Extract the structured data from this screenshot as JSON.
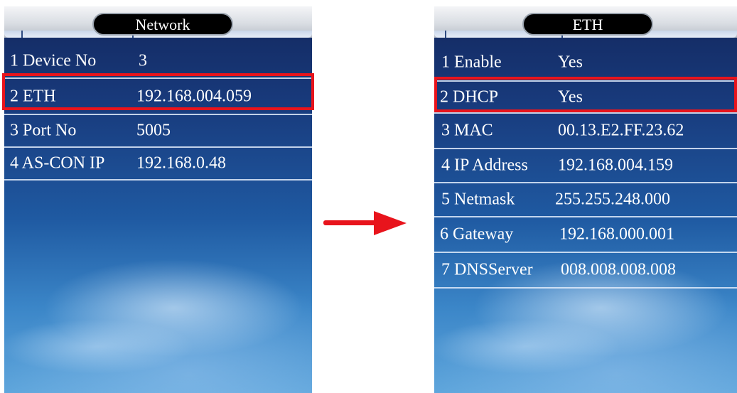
{
  "left_screen": {
    "title": "Network",
    "rows": [
      {
        "label": "1 Device No",
        "value": "3"
      },
      {
        "label": "2 ETH",
        "value": "192.168.004.059"
      },
      {
        "label": "3 Port No",
        "value": "5005"
      },
      {
        "label": "4 AS-CON IP",
        "value": "192.168.0.48"
      }
    ],
    "highlighted_row": "2 ETH"
  },
  "right_screen": {
    "title": "ETH",
    "rows": [
      {
        "label": "1 Enable",
        "value": "Yes"
      },
      {
        "label": "2 DHCP",
        "value": "Yes"
      },
      {
        "label": "3 MAC",
        "value": "00.13.E2.FF.23.62"
      },
      {
        "label": "4 IP Address",
        "value": "192.168.004.159"
      },
      {
        "label": "5 Netmask",
        "value": "255.255.248.000"
      },
      {
        "label": "6 Gateway",
        "value": "192.168.000.001"
      },
      {
        "label": "7 DNSServer",
        "value": "008.008.008.008"
      }
    ],
    "highlighted_row": "2 DHCP"
  },
  "colors": {
    "highlight": "#e8141c",
    "arrow": "#e8141c",
    "screen_top": "#13285e",
    "screen_bottom": "#5fa6dc",
    "title_pill": "#000000",
    "text": "#ffffff"
  },
  "icons": {
    "transition": "right-arrow-icon"
  }
}
